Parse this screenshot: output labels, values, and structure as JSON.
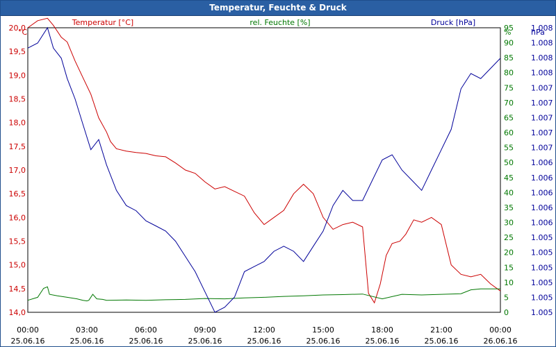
{
  "chart_data": {
    "type": "line",
    "title": "Temperatur, Feuchte & Druck",
    "series_labels": {
      "temperature": "Temperatur [°C]",
      "humidity": "rel. Feuchte [%]",
      "pressure": "Druck [hPa]"
    },
    "colors": {
      "temperature": "#cc0000",
      "humidity": "#007700",
      "pressure": "#000099",
      "titlebar": "#2a5fa3"
    },
    "axes": {
      "temperature": {
        "unit": "°C",
        "range": [
          14.0,
          20.0
        ],
        "ticks": [
          "14,0",
          "14,5",
          "15,0",
          "15,5",
          "16,0",
          "16,5",
          "17,0",
          "17,5",
          "18,0",
          "18,5",
          "19,0",
          "19,5",
          "20,0"
        ]
      },
      "humidity": {
        "unit": "%",
        "range": [
          0,
          95
        ],
        "ticks": [
          "0",
          "5",
          "10",
          "15",
          "20",
          "25",
          "30",
          "35",
          "40",
          "45",
          "50",
          "55",
          "60",
          "65",
          "70",
          "75",
          "80",
          "85",
          "90",
          "95"
        ]
      },
      "pressure": {
        "unit": "hPa",
        "ticks": [
          "1.005",
          "1.005",
          "1.005",
          "1.005",
          "1.005",
          "1.005",
          "1.006",
          "1.006",
          "1.006",
          "1.006",
          "1.006",
          "1.007",
          "1.007",
          "1.007",
          "1.007",
          "1.007",
          "1.008",
          "1.008",
          "1.008",
          "1.008"
        ]
      },
      "x": {
        "range": [
          0,
          24
        ],
        "ticks": [
          {
            "time": "00:00",
            "date": "25.06.16"
          },
          {
            "time": "03:00",
            "date": "25.06.16"
          },
          {
            "time": "06:00",
            "date": "25.06.16"
          },
          {
            "time": "09:00",
            "date": "25.06.16"
          },
          {
            "time": "12:00",
            "date": "25.06.16"
          },
          {
            "time": "15:00",
            "date": "25.06.16"
          },
          {
            "time": "18:00",
            "date": "25.06.16"
          },
          {
            "time": "21:00",
            "date": "25.06.16"
          },
          {
            "time": "00:00",
            "date": "26.06.16"
          }
        ]
      }
    },
    "grid": true,
    "series": [
      {
        "name": "Temperatur [°C]",
        "axis": "temperature",
        "x": [
          0,
          0.5,
          1.0,
          1.3,
          1.7,
          2.0,
          2.4,
          2.8,
          3.2,
          3.6,
          4.0,
          4.2,
          4.5,
          5.0,
          5.5,
          6.0,
          6.5,
          7.0,
          7.5,
          8.0,
          8.5,
          9.0,
          9.5,
          10.0,
          10.5,
          11.0,
          11.5,
          12.0,
          12.5,
          13.0,
          13.5,
          14.0,
          14.5,
          15.0,
          15.5,
          16.0,
          16.5,
          17.0,
          17.3,
          17.6,
          17.9,
          18.2,
          18.5,
          18.9,
          19.2,
          19.6,
          20.0,
          20.5,
          21.0,
          21.5,
          22.0,
          22.5,
          23.0,
          23.5,
          24.0
        ],
        "y": [
          20.0,
          20.15,
          20.2,
          20.05,
          19.8,
          19.7,
          19.3,
          18.95,
          18.6,
          18.1,
          17.8,
          17.6,
          17.45,
          17.4,
          17.37,
          17.35,
          17.3,
          17.28,
          17.15,
          17.0,
          16.93,
          16.75,
          16.6,
          16.65,
          16.55,
          16.45,
          16.1,
          15.85,
          16.0,
          16.15,
          16.5,
          16.7,
          16.5,
          16.0,
          15.75,
          15.85,
          15.9,
          15.8,
          14.4,
          14.2,
          14.6,
          15.2,
          15.45,
          15.5,
          15.65,
          15.95,
          15.9,
          16.0,
          15.85,
          15.0,
          14.8,
          14.75,
          14.8,
          14.6,
          14.45
        ]
      },
      {
        "name": "rel. Feuchte [%]",
        "axis": "humidity",
        "x": [
          0,
          0.5,
          0.8,
          1.0,
          1.1,
          1.5,
          2.0,
          2.5,
          2.8,
          3.0,
          3.1,
          3.3,
          3.5,
          3.8,
          4.0,
          5.0,
          6.0,
          7.0,
          8.0,
          9.0,
          10.0,
          11.0,
          12.0,
          13.0,
          14.0,
          15.0,
          16.0,
          17.0,
          18.0,
          19.0,
          20.0,
          21.0,
          22.0,
          22.5,
          23.0,
          24.0
        ],
        "y": [
          4,
          5,
          8,
          8.5,
          6,
          5.5,
          5,
          4.5,
          4,
          3.8,
          4,
          6,
          4.5,
          4.3,
          4,
          4.1,
          4,
          4.2,
          4.3,
          4.6,
          4.5,
          4.8,
          5.0,
          5.3,
          5.5,
          5.8,
          5.9,
          6.1,
          4.5,
          6.0,
          5.8,
          6.0,
          6.2,
          7.5,
          7.8,
          7.8
        ]
      },
      {
        "name": "Druck [hPa]",
        "axis": "pressure",
        "x": [
          0,
          0.5,
          1.0,
          1.3,
          1.7,
          2.0,
          2.4,
          2.8,
          3.2,
          3.6,
          4.0,
          4.5,
          5.0,
          5.5,
          6.0,
          6.5,
          7.0,
          7.5,
          8.0,
          8.5,
          9.0,
          9.5,
          10.0,
          10.5,
          11.0,
          11.5,
          12.0,
          12.5,
          13.0,
          13.5,
          14.0,
          14.5,
          15.0,
          15.5,
          16.0,
          16.5,
          17.0,
          17.5,
          18.0,
          18.5,
          19.0,
          19.5,
          20.0,
          20.5,
          21.0,
          21.5,
          22.0,
          22.5,
          23.0,
          23.5,
          24.0
        ],
        "y": [
          1.0078,
          1.00785,
          1.008,
          1.0078,
          1.0077,
          1.0075,
          1.0073,
          1.00705,
          1.0068,
          1.0069,
          1.00665,
          1.0064,
          1.00625,
          1.0062,
          1.0061,
          1.00605,
          1.006,
          1.0059,
          1.00575,
          1.0056,
          1.0054,
          1.0052,
          1.00525,
          1.00535,
          1.0056,
          1.00565,
          1.0057,
          1.0058,
          1.00585,
          1.0058,
          1.0057,
          1.00585,
          1.006,
          1.00625,
          1.0064,
          1.0063,
          1.0063,
          1.0065,
          1.0067,
          1.00675,
          1.0066,
          1.0065,
          1.0064,
          1.0066,
          1.0068,
          1.007,
          1.0074,
          1.00755,
          1.0075,
          1.0076,
          1.0077
        ]
      }
    ]
  }
}
